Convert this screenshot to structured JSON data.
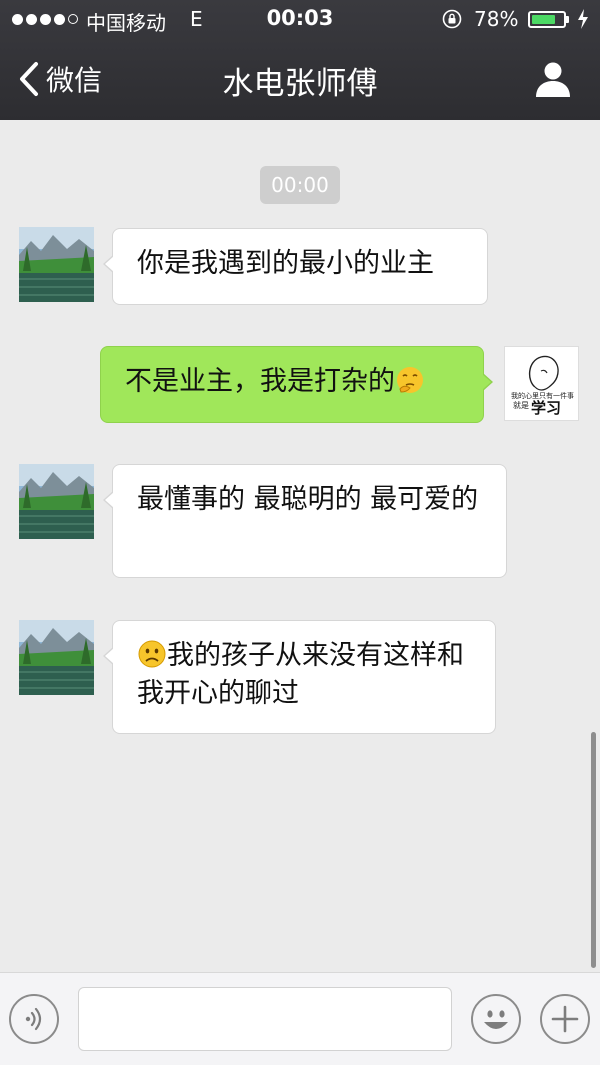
{
  "status_bar": {
    "carrier": "中国移动",
    "network": "E",
    "time": "00:03",
    "battery_percent": "78%",
    "battery_level": 0.78,
    "signal_bars_filled": 4,
    "signal_bars_total": 5
  },
  "nav": {
    "back_label": "微信",
    "title": "水电张师傅",
    "back_icon": "chevron-left-icon",
    "profile_icon": "person-icon"
  },
  "chat": {
    "timestamp": "00:00",
    "messages": [
      {
        "side": "left",
        "text": "你是我遇到的最小的业主"
      },
      {
        "side": "right",
        "text": "不是业主，我是打杂的",
        "emoji": "thinking-face-emoji"
      },
      {
        "side": "left",
        "text": "最懂事的 最聪明的 最可爱的"
      },
      {
        "side": "left",
        "text": "我的孩子从来没有这样和我开心的聊过",
        "emoji": "frowning-face-emoji"
      }
    ],
    "my_avatar_caption": {
      "line1": "我的心里只有一件事",
      "line2": "就是",
      "line3": "学习"
    }
  },
  "input_bar": {
    "voice_icon": "voice-icon",
    "emoji_icon": "smiley-icon",
    "plus_icon": "plus-icon",
    "text_value": ""
  },
  "colors": {
    "nav_bg": "#2d2d31",
    "chat_bg": "#ebebeb",
    "my_bubble": "#a0e75a",
    "their_bubble": "#ffffff",
    "battery_green": "#4cd964"
  }
}
